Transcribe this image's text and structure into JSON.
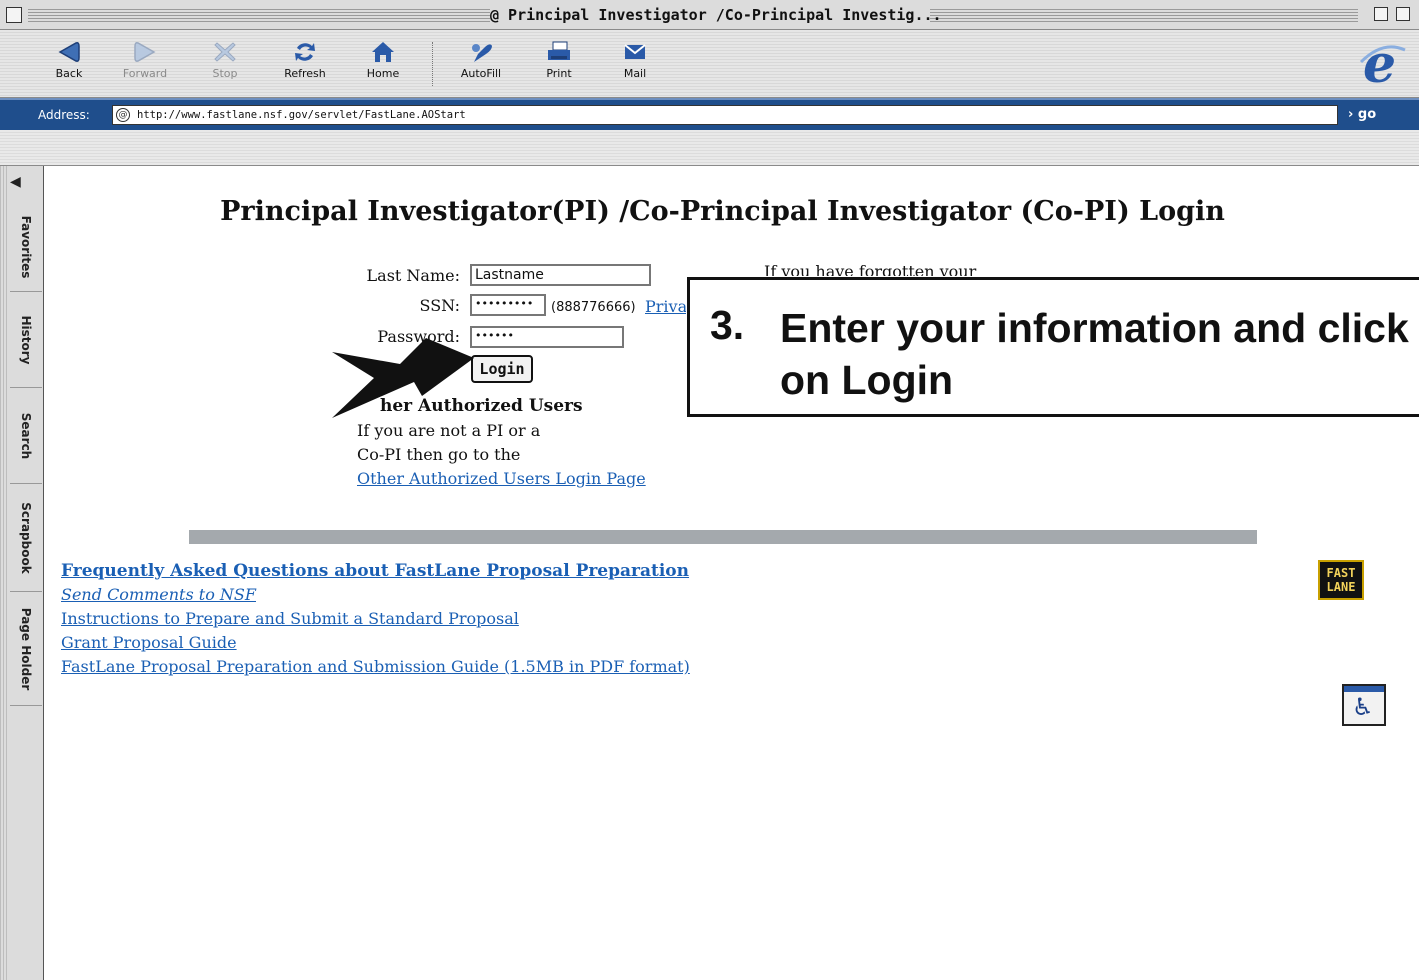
{
  "window": {
    "title": "@ Principal Investigator /Co-Principal Investig..."
  },
  "toolbar": {
    "buttons": [
      {
        "label": "Back",
        "icon": "back-arrow-icon",
        "enabled": true
      },
      {
        "label": "Forward",
        "icon": "forward-arrow-icon",
        "enabled": false
      },
      {
        "label": "Stop",
        "icon": "stop-x-icon",
        "enabled": false
      },
      {
        "label": "Refresh",
        "icon": "refresh-icon",
        "enabled": true
      },
      {
        "label": "Home",
        "icon": "home-icon",
        "enabled": true
      },
      {
        "label": "AutoFill",
        "icon": "autofill-icon",
        "enabled": true
      },
      {
        "label": "Print",
        "icon": "printer-icon",
        "enabled": true
      },
      {
        "label": "Mail",
        "icon": "mail-icon",
        "enabled": true
      }
    ]
  },
  "address": {
    "label": "Address:",
    "url": "http://www.fastlane.nsf.gov/servlet/FastLane.AOStart",
    "go_label": "go"
  },
  "sidebar": {
    "tabs": [
      "Favorites",
      "History",
      "Search",
      "Scrapbook",
      "Page Holder"
    ]
  },
  "page": {
    "title": "Principal Investigator(PI) /Co-Principal Investigator (Co-PI) Login",
    "form": {
      "last_name_label": "Last Name:",
      "last_name_value": "Lastname",
      "ssn_label": "SSN:",
      "ssn_value": "•••••••••",
      "ssn_hint": "(888776666)",
      "privacy_link": "Priva",
      "password_label": "Password:",
      "password_value": "••••••",
      "login_label": "Login"
    },
    "forgot_text": "If you have forgotten your",
    "other_users": {
      "heading_visible": "her Authorized Users",
      "line1": "If you are not a PI or a",
      "line2": "Co-PI then go to the",
      "link": "Other Authorized Users Login Page"
    },
    "links": [
      {
        "text": "Frequently Asked Questions about FastLane Proposal Preparation",
        "style": "bold"
      },
      {
        "text": "Send Comments to NSF",
        "style": "italic"
      },
      {
        "text": "Instructions to Prepare and Submit a Standard Proposal",
        "style": "normal"
      },
      {
        "text": "Grant Proposal Guide",
        "style": "normal"
      },
      {
        "text": "FastLane Proposal Preparation and Submission Guide (1.5MB in PDF format)",
        "style": "normal"
      }
    ],
    "fastlane_logo": {
      "line1": "FAST",
      "line2": "LANE"
    },
    "accessibility_icon": "wheelchair-icon"
  },
  "callout": {
    "number": "3.",
    "text": "Enter your information and click on Login"
  },
  "colors": {
    "link": "#1a5fb4",
    "address_bar": "#1f4e8c",
    "rule": "#a4a9ad"
  }
}
